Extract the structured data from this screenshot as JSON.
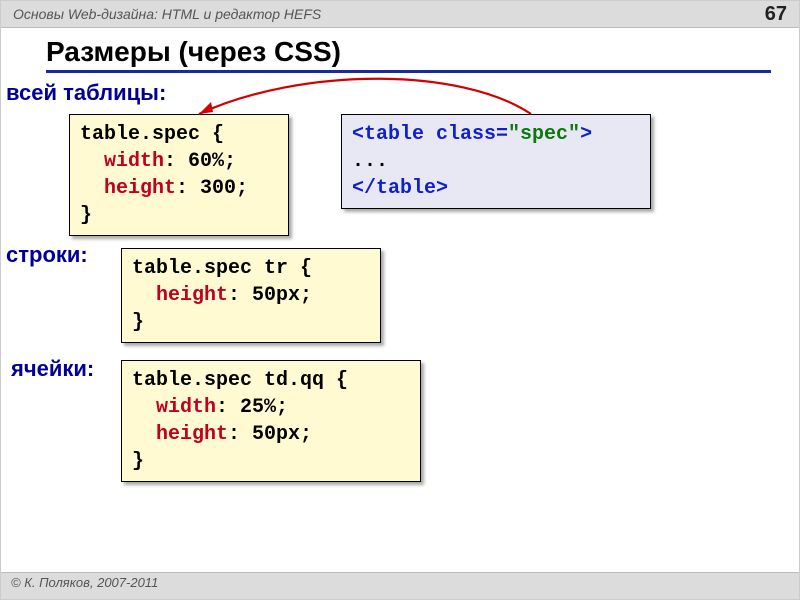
{
  "header": {
    "breadcrumb": "Основы Web-дизайна: HTML и редактор HEFS",
    "page_number": "67"
  },
  "title": "Размеры (через CSS)",
  "labels": {
    "whole_table": "всей таблицы:",
    "row": "строки:",
    "cell": "ячейки:"
  },
  "code": {
    "css_table": {
      "selector": "table.spec {",
      "indent1_prop": "width",
      "indent1_colon_val": ": 60%;",
      "indent2_prop": "height",
      "indent2_colon_val": ": 300;",
      "close": "}"
    },
    "html_table": {
      "line1_a": "<table ",
      "line1_attr": "class",
      "line1_eq": "=",
      "line1_val": "\"spec\"",
      "line1_b": ">",
      "line2": "...",
      "line3": "</table>"
    },
    "css_row": {
      "selector": "table.spec tr {",
      "indent1_prop": "height",
      "indent1_colon_val": ": 50px;",
      "close": "}"
    },
    "css_cell": {
      "selector": "table.spec td.qq {",
      "indent1_prop": "width",
      "indent1_colon_val": ": 25%;",
      "indent2_prop": "height",
      "indent2_colon_val": ": 50px;",
      "close": "}"
    }
  },
  "footer": "© К. Поляков, 2007-2011"
}
